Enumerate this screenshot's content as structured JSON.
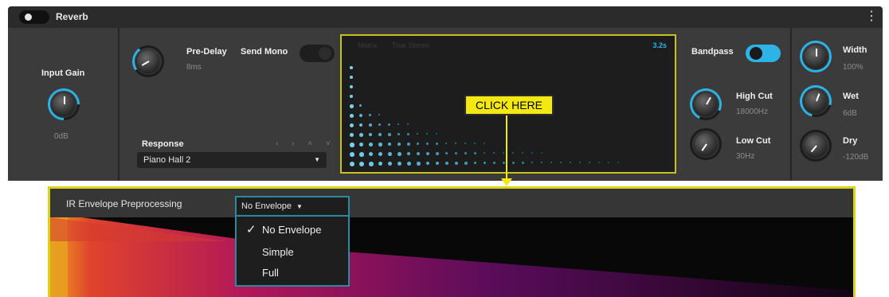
{
  "plugin": {
    "name": "Reverb"
  },
  "input": {
    "label": "Input Gain",
    "value": "0dB"
  },
  "predelay": {
    "label": "Pre-Delay",
    "value": "8ms"
  },
  "send_mono": {
    "label": "Send Mono",
    "on": false
  },
  "response": {
    "label": "Response",
    "selected": "Piano Hall 2",
    "nav": "‹ › ˄ ˅"
  },
  "display": {
    "tabs": [
      "Matrix",
      "True Stereo"
    ],
    "duration": "3.2s"
  },
  "callout": {
    "text": "CLICK HERE"
  },
  "bandpass": {
    "label": "Bandpass",
    "on": true
  },
  "high_cut": {
    "label": "High Cut",
    "value": "18000Hz"
  },
  "low_cut": {
    "label": "Low Cut",
    "value": "30Hz"
  },
  "width": {
    "label": "Width",
    "value": "100%"
  },
  "wet": {
    "label": "Wet",
    "value": "6dB"
  },
  "dry": {
    "label": "Dry",
    "value": "-120dB"
  },
  "envelope": {
    "title": "IR Envelope Preprocessing",
    "selected": "No Envelope",
    "options": [
      "No Envelope",
      "Simple",
      "Full"
    ],
    "checked_index": 0
  },
  "colors": {
    "accent": "#2db3e6",
    "highlight": "#f4e813",
    "panel": "#3a3a3a"
  }
}
